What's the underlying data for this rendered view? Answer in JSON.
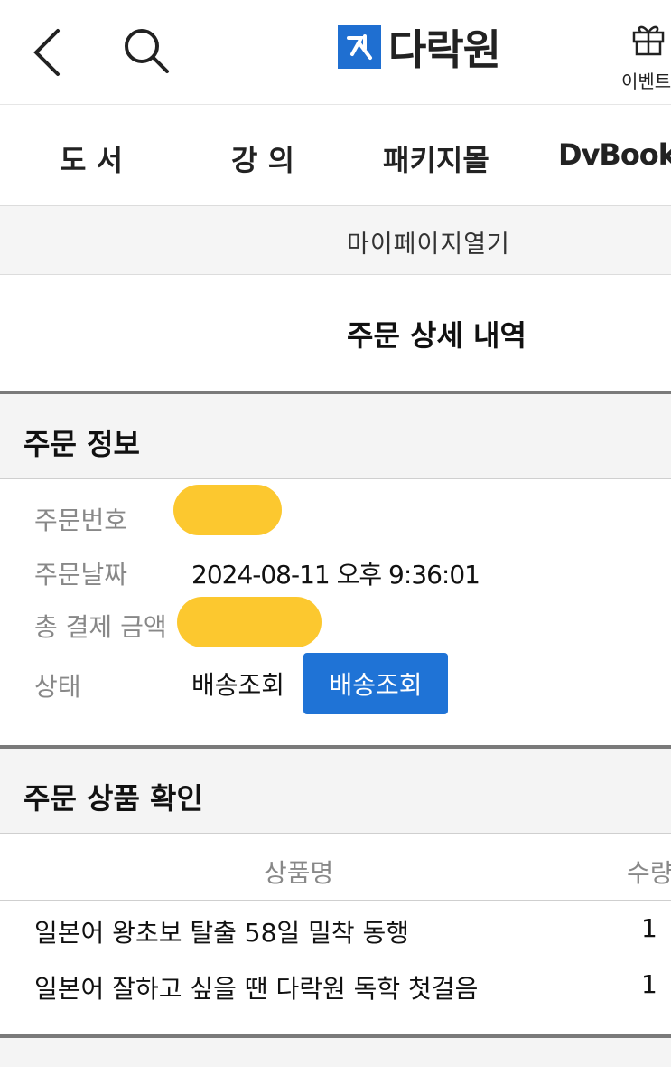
{
  "header": {
    "logo_text": "다락원",
    "event_label": "이벤트"
  },
  "nav": {
    "items": [
      {
        "label": "도 서"
      },
      {
        "label": "강 의"
      },
      {
        "label": "패키지몰"
      },
      {
        "label": "DvBook"
      }
    ]
  },
  "mypage": {
    "label": "마이페이지열기"
  },
  "page": {
    "title": "주문 상세 내역"
  },
  "order_info": {
    "section_title": "주문 정보",
    "labels": {
      "order_number": "주문번호",
      "order_date": "주문날짜",
      "total_amount": "총 결제 금액",
      "status": "상태"
    },
    "values": {
      "order_date": "2024-08-11 오후 9:36:01",
      "status": "배송조회"
    },
    "track_button": "배송조회"
  },
  "order_items": {
    "section_title": "주문 상품 확인",
    "columns": {
      "name": "상품명",
      "qty": "수량"
    },
    "rows": [
      {
        "name": "일본어 왕초보 탈출 58일 밀착 동행",
        "qty": "1"
      },
      {
        "name": "일본어 잘하고 싶을 땐 다락원 독학 첫걸음",
        "qty": "1"
      }
    ]
  },
  "colors": {
    "accent_blue": "#1f73d6",
    "redaction_yellow": "#fcc82f"
  }
}
